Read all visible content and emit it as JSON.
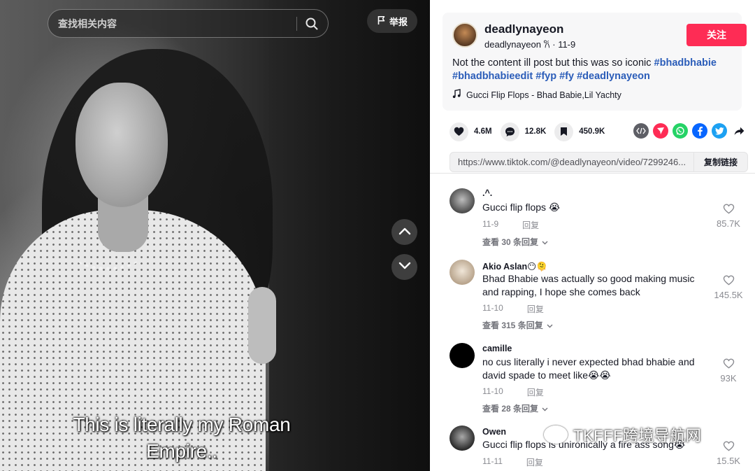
{
  "search": {
    "placeholder": "查找相关内容"
  },
  "report": {
    "label": "举报"
  },
  "video": {
    "caption_line1": "This is literally my Roman",
    "caption_line2": "Empire.."
  },
  "author": {
    "username": "deadlynayeon",
    "handle": "deadlynayeon",
    "handle_glyph": "𐙚",
    "date": "11-9",
    "follow_label": "关注"
  },
  "description": {
    "text": "Not the content ill post but this was so iconic",
    "tags": [
      "#bhadbhabie",
      "#bhadbhabieedit",
      "#fyp",
      "#fy",
      "#deadlynayeon"
    ]
  },
  "music": {
    "title": "Gucci Flip Flops - Bhad Babie,Lil Yachty",
    "icon": "music-note-icon"
  },
  "stats": {
    "likes": "4.6M",
    "comments": "12.8K",
    "saves": "450.9K"
  },
  "share_icons": [
    "embed-icon",
    "send-icon",
    "whatsapp-icon",
    "facebook-icon",
    "twitter-icon",
    "share-arrow-icon"
  ],
  "share_colors": {
    "embed": "#5e5f66",
    "send": "#fe2c55",
    "whatsapp": "#25d366",
    "facebook": "#0866ff",
    "twitter": "#1da1f2"
  },
  "link": {
    "url": "https://www.tiktok.com/@deadlynayeon/video/7299246...",
    "copy_label": "复制链接"
  },
  "comments": [
    {
      "name": ".^.",
      "text": "Gucci flip flops 😭",
      "date": "11-9",
      "reply_label": "回复",
      "replies_label": "查看 30 条回复",
      "likes": "85.7K"
    },
    {
      "name": "Akio Aslan😶🫠",
      "text": "Bhad Bhabie was actually so good making music and rapping, I hope she comes back",
      "date": "11-10",
      "reply_label": "回复",
      "replies_label": "查看 315 条回复",
      "likes": "145.5K"
    },
    {
      "name": "camille",
      "text": "no cus literally i never expected bhad bhabie and david spade to meet like😭😭",
      "date": "11-10",
      "reply_label": "回复",
      "replies_label": "查看 28 条回复",
      "likes": "93K"
    },
    {
      "name": "Owen",
      "text": "Gucci flip flops is unironically a fire ass song😭",
      "date": "11-11",
      "reply_label": "回复",
      "replies_label": "",
      "likes": "15.5K"
    }
  ],
  "watermark": {
    "text": "TKFFF跨境导航网"
  },
  "colors": {
    "accent": "#fe2c55",
    "hashtag": "#2b5db9",
    "muted": "#8a8b91"
  }
}
